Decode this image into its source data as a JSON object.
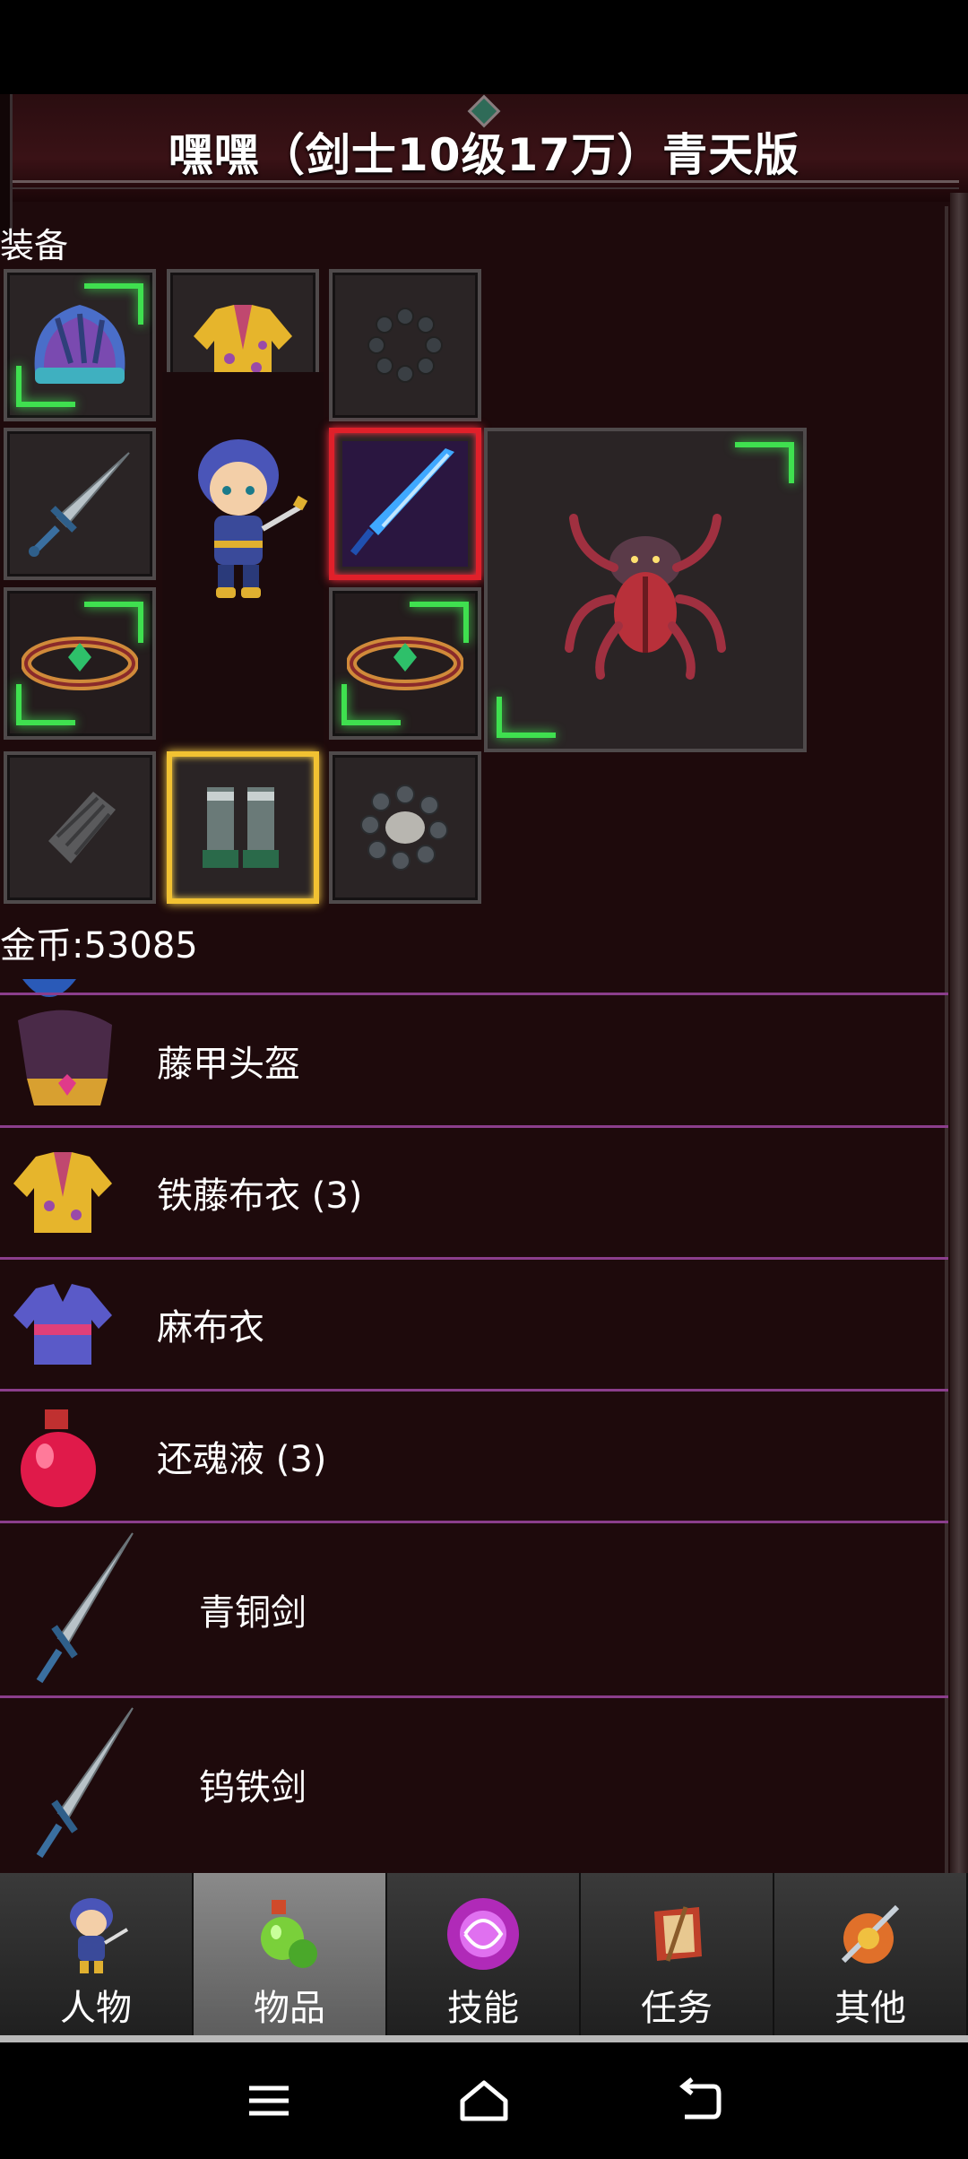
{
  "window": {
    "title": "嘿嘿（剑士10级17万）青天版"
  },
  "equipment": {
    "section_label": "装备",
    "slots": [
      {
        "name": "helmet",
        "icon": "helmet-icon"
      },
      {
        "name": "armor",
        "icon": "robe-icon"
      },
      {
        "name": "necklace",
        "icon": "bead-necklace-icon"
      },
      {
        "name": "weapon",
        "icon": "sword-icon"
      },
      {
        "name": "special-weapon",
        "icon": "blue-blade-icon"
      },
      {
        "name": "ring-left",
        "icon": "ring-icon"
      },
      {
        "name": "ring-right",
        "icon": "ring-icon"
      },
      {
        "name": "gloves",
        "icon": "bracer-icon"
      },
      {
        "name": "boots",
        "icon": "boots-icon"
      },
      {
        "name": "bracelet",
        "icon": "bracelet-icon"
      },
      {
        "name": "pet",
        "icon": "spider-monster-icon"
      }
    ]
  },
  "currency": {
    "label": "金币:53085"
  },
  "inventory": [
    {
      "label": "藤甲头盔",
      "icon": "helmet-icon"
    },
    {
      "label": "铁藤布衣 (3)",
      "icon": "robe-icon"
    },
    {
      "label": "麻布衣",
      "icon": "cloth-icon"
    },
    {
      "label": "还魂液 (3)",
      "icon": "potion-icon"
    },
    {
      "label": "青铜剑",
      "icon": "sword-icon"
    },
    {
      "label": "钨铁剑",
      "icon": "sword-icon"
    }
  ],
  "nav": {
    "tabs": [
      {
        "label": "人物",
        "icon": "character-icon",
        "active": false
      },
      {
        "label": "物品",
        "icon": "potion-bag-icon",
        "active": true
      },
      {
        "label": "技能",
        "icon": "skill-orb-icon",
        "active": false
      },
      {
        "label": "任务",
        "icon": "quest-scroll-icon",
        "active": false
      },
      {
        "label": "其他",
        "icon": "misc-icon",
        "active": false
      }
    ]
  },
  "system": {
    "buttons": [
      "menu-icon",
      "home-icon",
      "back-icon"
    ]
  },
  "colors": {
    "frame": "#1e0a0c",
    "divider": "#8b3e8c",
    "glow": "#3fe04f",
    "nav_active": "#8a8a8a"
  }
}
